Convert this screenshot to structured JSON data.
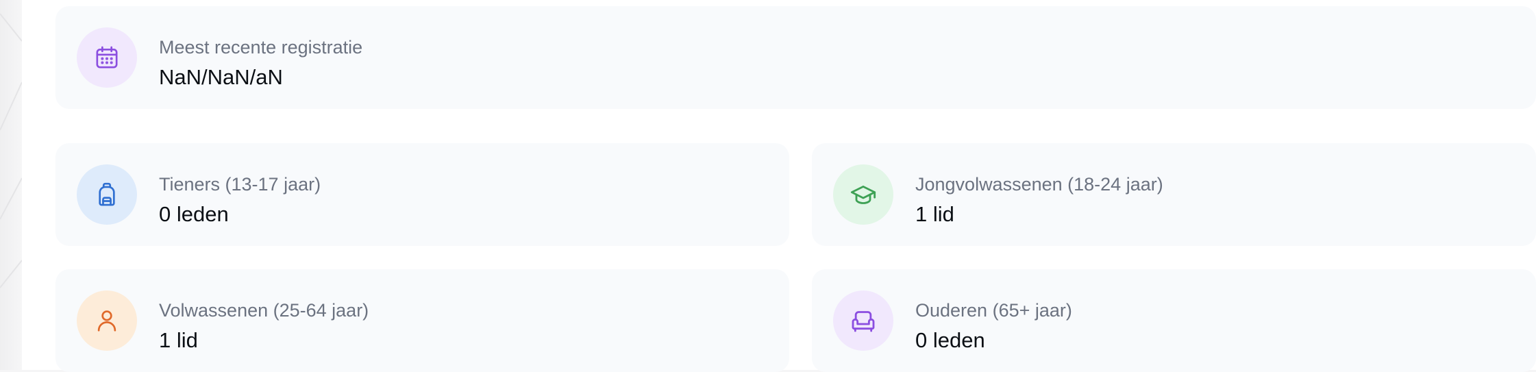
{
  "cards": {
    "recent": {
      "label": "Meest recente registratie",
      "value": "NaN/NaN/aN",
      "icon": "calendar-icon",
      "color": "#8b4ee0"
    },
    "teens": {
      "label": "Tieners (13-17 jaar)",
      "value": "0 leden",
      "icon": "backpack-icon",
      "color": "#2f6fd1"
    },
    "young_adults": {
      "label": "Jongvolwassenen (18-24 jaar)",
      "value": "1 lid",
      "icon": "graduation-cap-icon",
      "color": "#3ea155"
    },
    "adults": {
      "label": "Volwassenen (25-64 jaar)",
      "value": "1 lid",
      "icon": "user-icon",
      "color": "#e0692a"
    },
    "seniors": {
      "label": "Ouderen (65+ jaar)",
      "value": "0 leden",
      "icon": "armchair-icon",
      "color": "#8b4ee0"
    }
  }
}
